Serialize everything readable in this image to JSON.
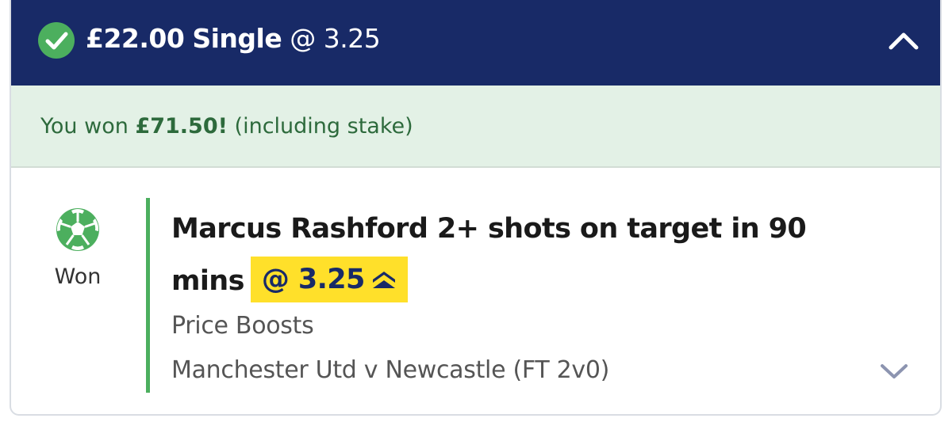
{
  "header": {
    "stake": "£22.00",
    "bet_type": "Single",
    "odds": "@ 3.25",
    "status_icon": "check-circle-icon",
    "collapse_icon": "chevron-up-icon",
    "background_color": "#182a67"
  },
  "result_banner": {
    "prefix": "You won",
    "amount": "£71.50!",
    "suffix": "(including stake)",
    "background_color": "#e3f1e6",
    "text_color": "#2d6a3c"
  },
  "selection": {
    "sport_icon": "football-icon",
    "status": "Won",
    "title": "Marcus Rashford 2+ shots on target in 90 mins",
    "odds": "@ 3.25",
    "boost_icon": "price-boost-icon",
    "market": "Price Boosts",
    "event": "Manchester Utd v Newcastle (FT 2v0)",
    "expand_icon": "chevron-down-icon",
    "status_color": "#4caf5e",
    "boost_color": "#ffe02a"
  }
}
